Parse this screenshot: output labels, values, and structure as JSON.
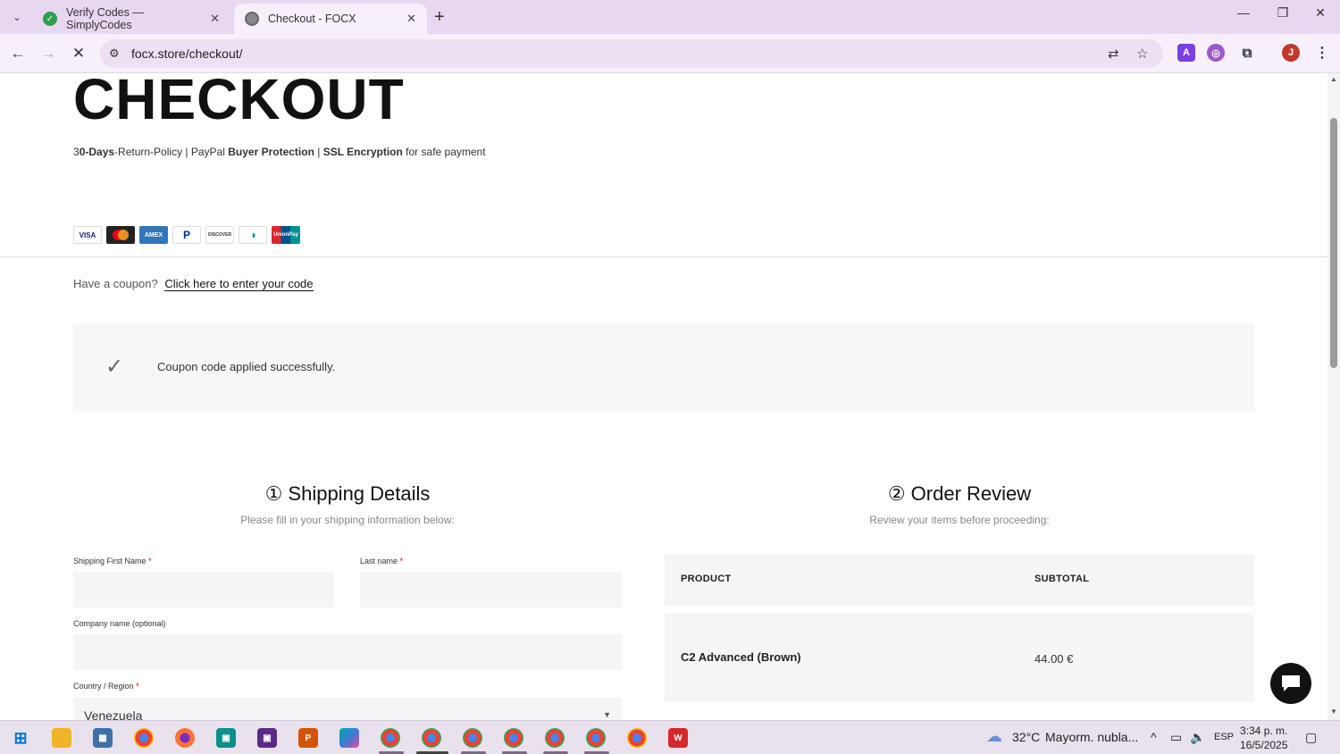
{
  "browser": {
    "tabs": [
      {
        "title": "Verify Codes — SimplyCodes",
        "active": false
      },
      {
        "title": "Checkout - FOCX",
        "active": true
      }
    ],
    "url": "focx.store/checkout/",
    "profile_initial": "J"
  },
  "page": {
    "heading": "CHECKOUT",
    "trust": {
      "part1_prefix": "3",
      "part1_bold": "0-Days",
      "part1_rest": "-Return-Policy | PayPal ",
      "part2_bold": "Buyer Protection",
      "sep": " | ",
      "part3_bold": "SSL Encryption",
      "part3_rest": " for safe payment"
    },
    "payment_cards": [
      "VISA",
      "MC",
      "AMEX",
      "PayPal",
      "DISCOVER",
      "Diners",
      "UnionPay"
    ],
    "coupon": {
      "prompt": "Have a coupon?",
      "link": "Click here to enter your code"
    },
    "notice": "Coupon code applied successfully.",
    "shipping": {
      "title": "① Shipping Details",
      "subtitle": "Please fill in your shipping information below:",
      "first_name_label": "Shipping First Name",
      "last_name_label": "Last name",
      "company_label": "Company name (optional)",
      "country_label": "Country / Region",
      "country_value": "Venezuela",
      "required_mark": "*"
    },
    "review": {
      "title": "② Order Review",
      "subtitle": "Review your items before proceeding:",
      "col_product": "PRODUCT",
      "col_subtotal": "SUBTOTAL",
      "items": [
        {
          "name": "C2 Advanced (Brown)",
          "subtotal": "44.00 €"
        }
      ]
    }
  },
  "taskbar": {
    "weather_temp": "32°C",
    "weather_desc": "Mayorm. nubla...",
    "language": "ESP",
    "time": "3:34 p. m.",
    "date": "16/5/2025"
  },
  "colors": {
    "tabbar": "#e8d7f1",
    "toolbar": "#f7f0fb",
    "accent_check": "#666666"
  }
}
